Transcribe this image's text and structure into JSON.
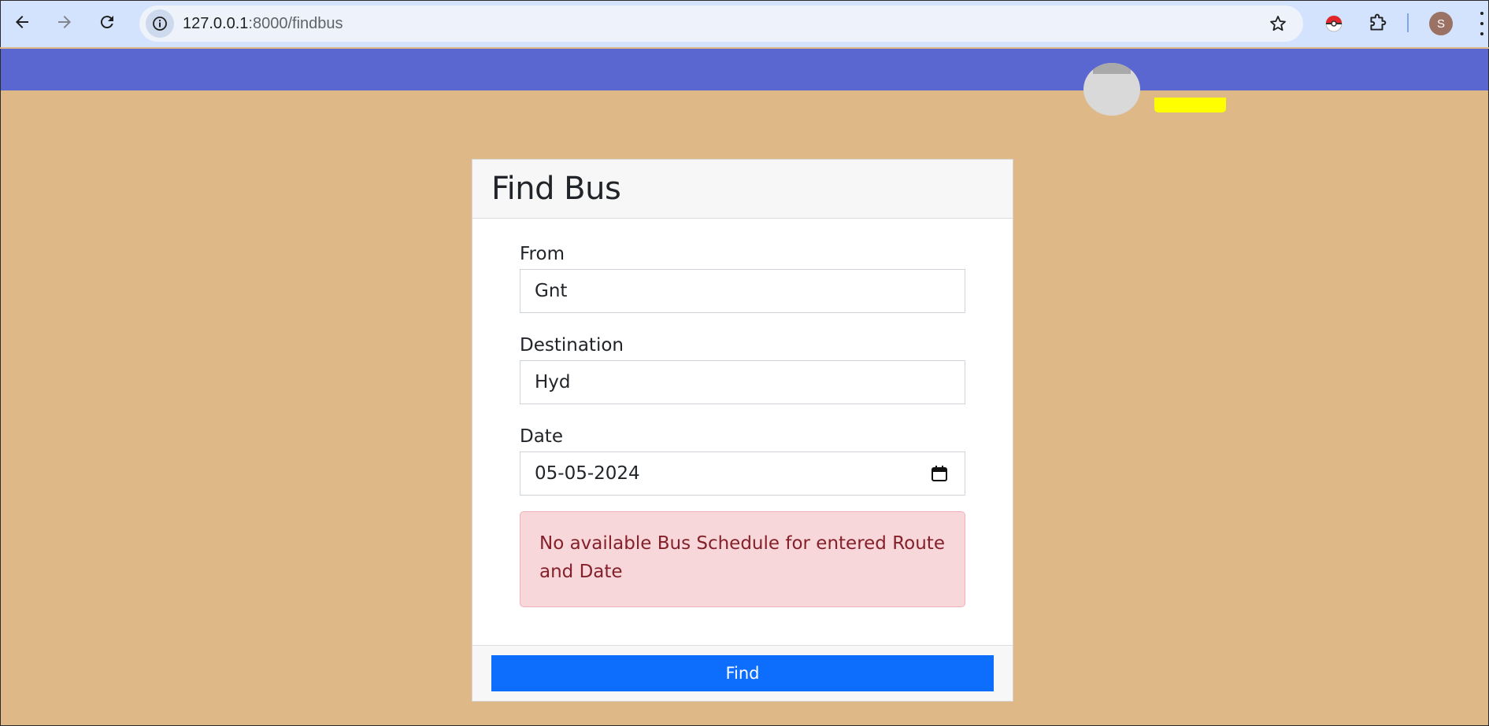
{
  "browser": {
    "url_host": "127.0.0.1",
    "url_rest": ":8000/findbus",
    "profile_initial": "S"
  },
  "card": {
    "title": "Find Bus",
    "fields": [
      {
        "label": "From",
        "value": "Gnt"
      },
      {
        "label": "Destination",
        "value": "Hyd"
      },
      {
        "label": "Date",
        "value": "05-05-2024"
      }
    ],
    "alert": "No available Bus Schedule for entered Route and Date",
    "submit_label": "Find"
  },
  "colors": {
    "page_background": "#deb887",
    "navbar": "#5b67d1",
    "primary_button": "#0d6efd",
    "alert_background": "#f8d7da",
    "alert_text": "#842029"
  },
  "icons": [
    "back-arrow-icon",
    "forward-arrow-icon",
    "reload-icon",
    "site-info-icon",
    "bookmark-star-icon",
    "pokeball-extension-icon",
    "extensions-puzzle-icon",
    "profile-avatar",
    "more-menu-icon",
    "calendar-icon"
  ]
}
